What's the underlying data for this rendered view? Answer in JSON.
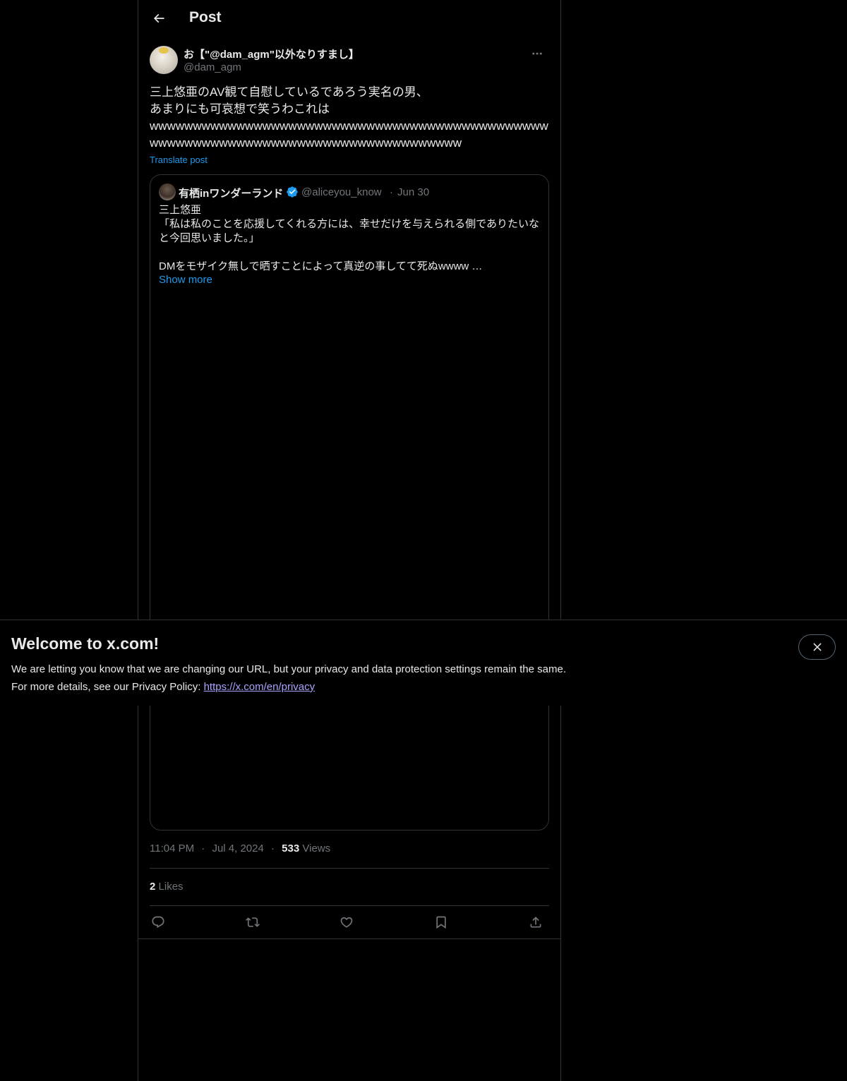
{
  "header": {
    "title": "Post",
    "back_icon": "arrow-left-icon"
  },
  "post": {
    "author_name": "お【\"@dam_agm\"以外なりすまし】",
    "author_handle": "@dam_agm",
    "text": "三上悠亜のAV観て自慰しているであろう実名の男、\nあまりにも可哀想で笑うわこれは\nwwwwwwwwwwwwwwwwwwwwwwwwwwwwwwwwwwwwwwwwwwwwwwwwwwwwwwwwwwwwwwwwwwwwwwwwwwwwwwwwww",
    "translate_label": "Translate post",
    "time": "11:04 PM",
    "date": "Jul 4, 2024",
    "views_count": "533",
    "views_label": "Views",
    "likes_count": "2",
    "likes_label": "Likes"
  },
  "quote": {
    "name": "有栖inワンダーランド",
    "handle": "@aliceyou_know",
    "separator": "·",
    "date": "Jun 30",
    "text": "三上悠亜\n「私は私のことを応援してくれる方には、幸せだけを与えられる側でありたいなと今回思いました。」\n\nDMをモザイク無しで晒すことによって真逆の事してて死ぬwwww …",
    "show_more": "Show more"
  },
  "banner": {
    "title": "Welcome to x.com!",
    "line1": "We are letting you know that we are changing our URL, but your privacy and data protection settings remain the same.",
    "line2_prefix": "For more details, see our Privacy Policy: ",
    "link": "https://x.com/en/privacy"
  },
  "meta_separator": "·",
  "colors": {
    "background": "#000000",
    "text": "#e7e9ea",
    "muted": "#71767b",
    "accent": "#1d9bf0",
    "border": "#2f3336",
    "link": "#a8a4ff"
  }
}
